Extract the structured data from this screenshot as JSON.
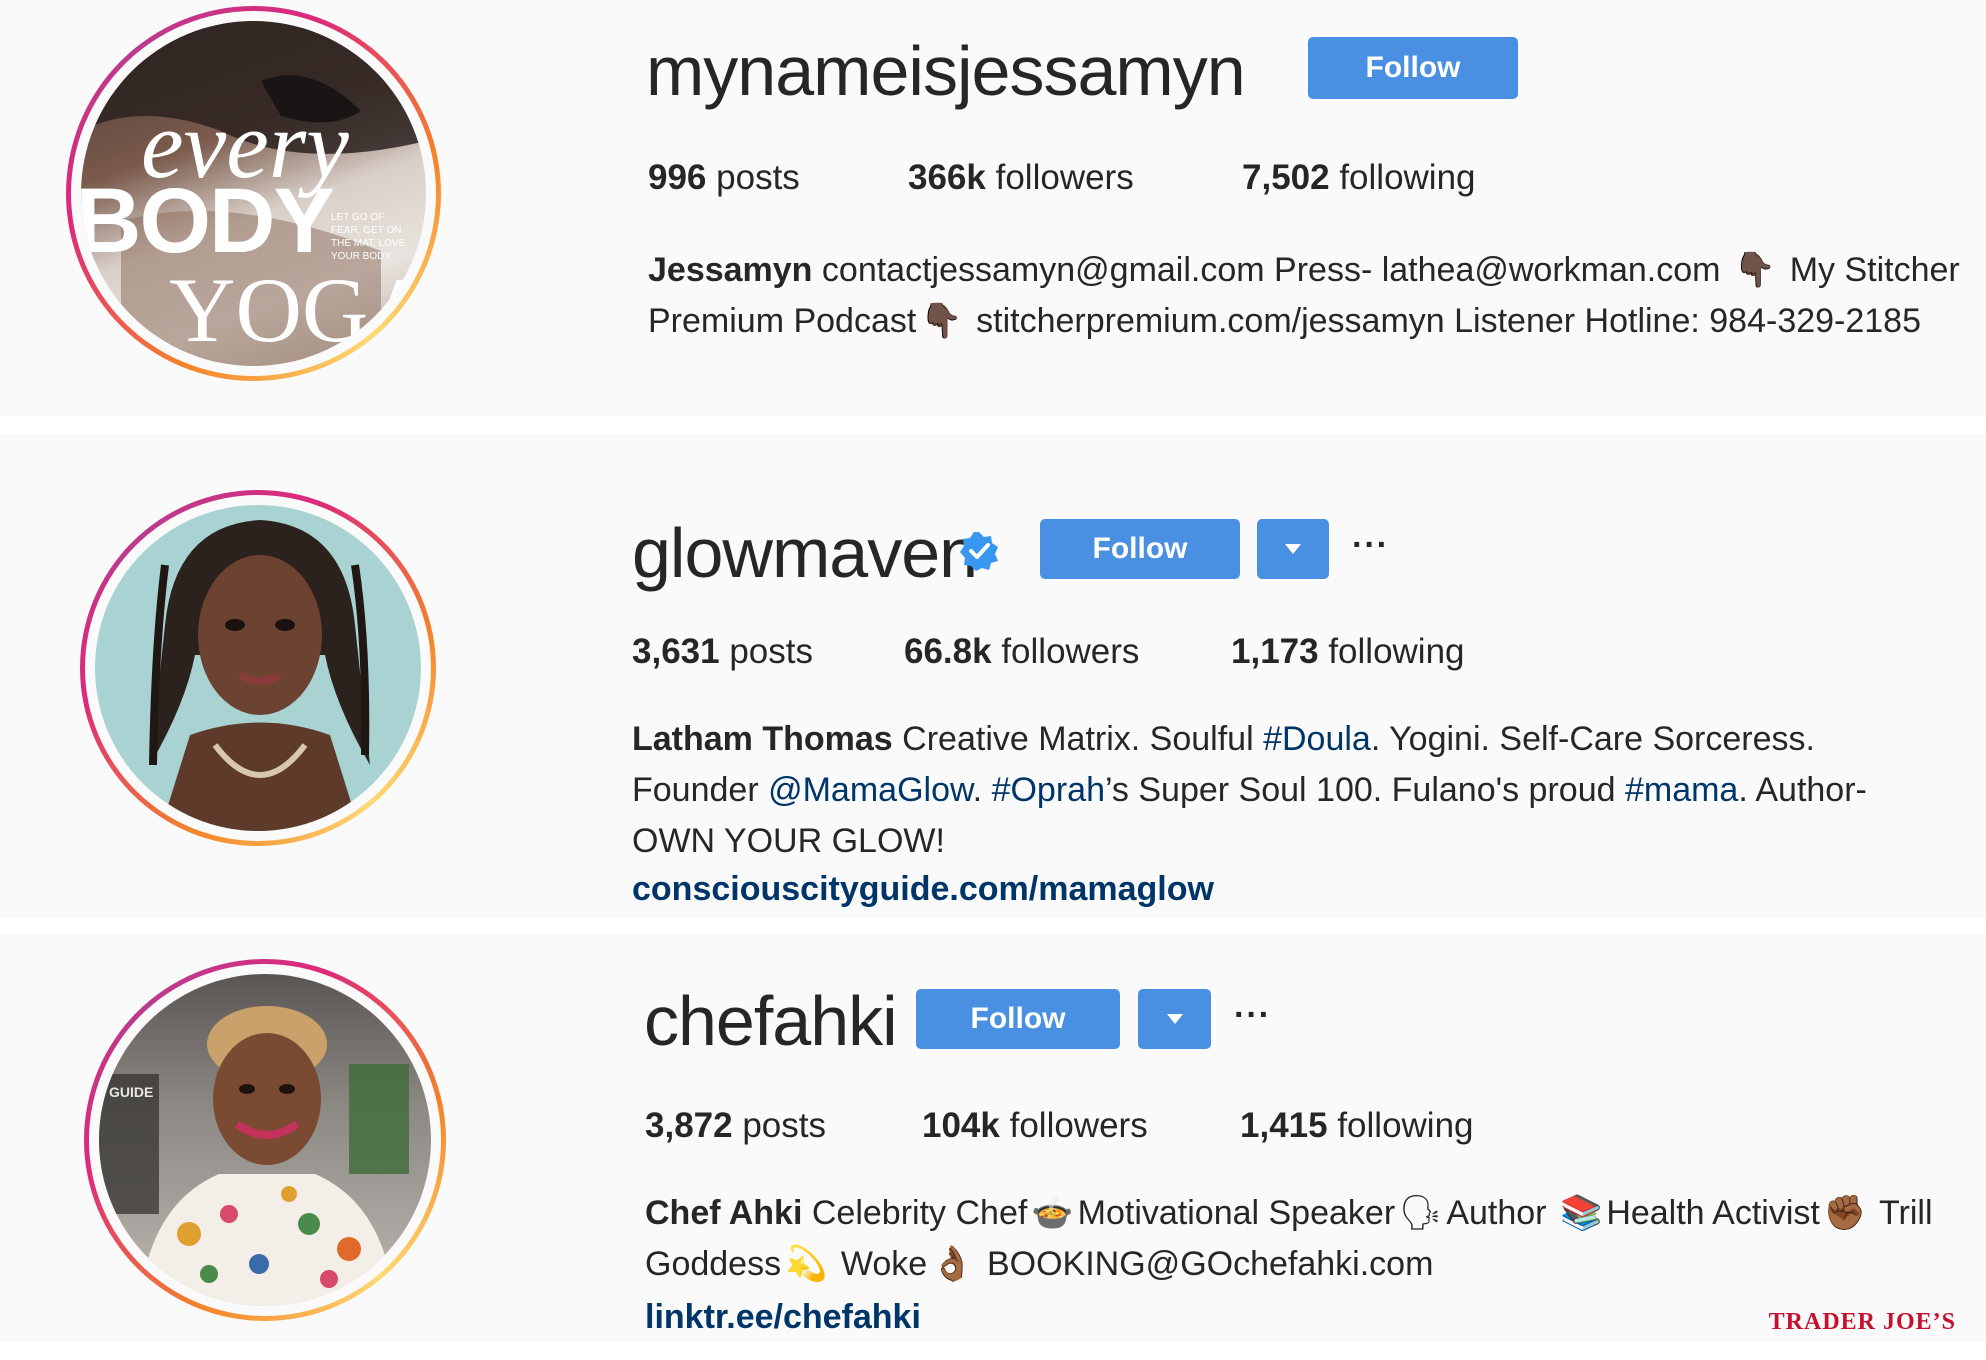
{
  "profiles": [
    {
      "username": "mynameisjessamyn",
      "follow_label": "Follow",
      "verified": false,
      "posts_count": "996",
      "posts_label": "posts",
      "followers_count": "366k",
      "followers_label": "followers",
      "following_count": "7,502",
      "following_label": "following",
      "bio_name": "Jessamyn",
      "bio_1": "contactjessamyn@gmail.com Press- lathea@workman.com",
      "emoji_1": "👇🏿",
      "bio_2": "My Stitcher Premium Podcast",
      "emoji_2": "👇🏿",
      "bio_3": "stitcherpremium.com/jessamyn Listener Hotline: 984-329-2185",
      "avatar_text": {
        "every": "every",
        "body": "BODY",
        "yoga": "YOGA",
        "tagline": "LET GO OF FEAR, GET ON THE MAT, LOVE YOUR BODY."
      }
    },
    {
      "username": "glowmaven",
      "follow_label": "Follow",
      "verified": true,
      "more_label": "···",
      "posts_count": "3,631",
      "posts_label": "posts",
      "followers_count": "66.8k",
      "followers_label": "followers",
      "following_count": "1,173",
      "following_label": "following",
      "bio_name": "Latham Thomas",
      "bio_1": "Creative Matrix. Soulful",
      "tag_doula": "#Doula",
      "bio_2": ". Yogini. Self-Care Sorceress. Founder",
      "tag_mamaglow": "@MamaGlow",
      "bio_3": ".",
      "tag_oprah": "#Oprah",
      "bio_4": "’s Super Soul 100. Fulano's proud",
      "tag_mama": "#mama",
      "bio_5": ". Author- OWN YOUR GLOW!",
      "link": "consciouscityguide.com/mamaglow"
    },
    {
      "username": "chefahki",
      "follow_label": "Follow",
      "verified": false,
      "more_label": "···",
      "posts_count": "3,872",
      "posts_label": "posts",
      "followers_count": "104k",
      "followers_label": "followers",
      "following_count": "1,415",
      "following_label": "following",
      "bio_name": "Chef Ahki",
      "bio_1": "Celebrity Chef",
      "emoji_1": "🍲",
      "bio_2": "Motivational Speaker",
      "emoji_2": "🗣",
      "bio_3": "Author",
      "emoji_3": "📚",
      "bio_4": "Health Activist",
      "emoji_4": "✊🏾",
      "bio_5": "Trill Goddess",
      "emoji_5": "💫",
      "bio_6": "Woke",
      "emoji_6": "👌🏾",
      "bio_7": "BOOKING@GOchefahki.com",
      "link": "linktr.ee/chefahki",
      "avatar_text": "GUIDE"
    }
  ],
  "watermark": "TRADER JOE’S",
  "colors": {
    "follow_button": "#4a90e2",
    "hashtag": "#003569",
    "verified": "#3897f0"
  }
}
